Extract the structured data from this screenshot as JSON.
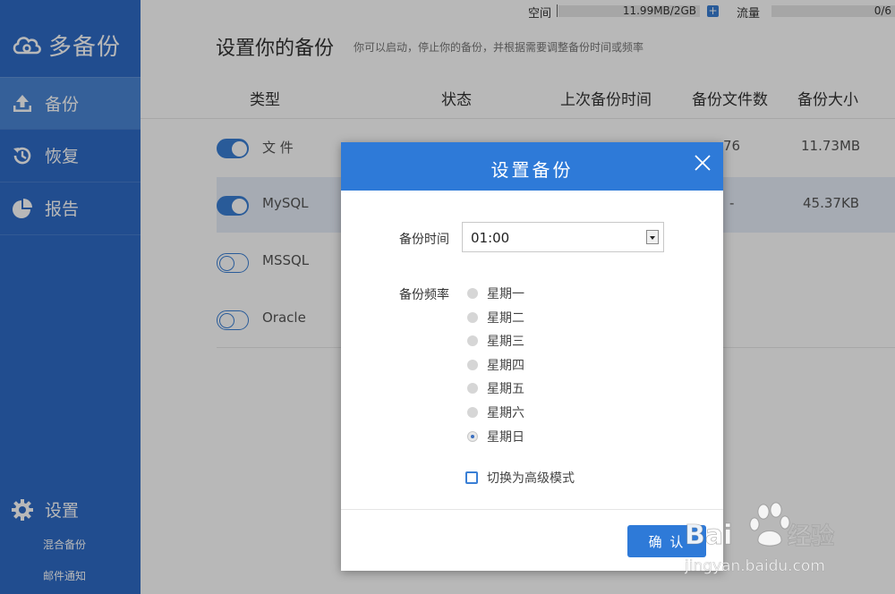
{
  "app": {
    "name": "多备份"
  },
  "sidebar": {
    "items": [
      {
        "label": "备份",
        "icon": "upload-icon",
        "active": true
      },
      {
        "label": "恢复",
        "icon": "history-icon",
        "active": false
      },
      {
        "label": "报告",
        "icon": "pie-chart-icon",
        "active": false
      }
    ],
    "settings": {
      "label": "设置",
      "icon": "gear-icon"
    },
    "sub_links": [
      "混合备份",
      "邮件通知"
    ]
  },
  "topbar": {
    "space_label": "空间",
    "space_value": "11.99MB/2GB",
    "traffic_label": "流量",
    "traffic_value": "0/6"
  },
  "page": {
    "title": "设置你的备份",
    "subtitle": "你可以启动，停止你的备份，并根据需要调整备份时间或频率"
  },
  "table": {
    "headers": [
      "类型",
      "状态",
      "上次备份时间",
      "备份文件数",
      "备份大小"
    ],
    "rows": [
      {
        "type": "文 件",
        "enabled": true,
        "files": "76",
        "size": "11.73MB"
      },
      {
        "type": "MySQL",
        "enabled": true,
        "files": "-",
        "size": "45.37KB"
      },
      {
        "type": "MSSQL",
        "enabled": false,
        "files": "",
        "size": ""
      },
      {
        "type": "Oracle",
        "enabled": false,
        "files": "",
        "size": ""
      }
    ]
  },
  "dialog": {
    "title": "设置备份",
    "time_label": "备份时间",
    "time_value": "01:00",
    "freq_label": "备份频率",
    "days": [
      {
        "label": "星期一",
        "checked": false
      },
      {
        "label": "星期二",
        "checked": false
      },
      {
        "label": "星期三",
        "checked": false
      },
      {
        "label": "星期四",
        "checked": false
      },
      {
        "label": "星期五",
        "checked": false
      },
      {
        "label": "星期六",
        "checked": false
      },
      {
        "label": "星期日",
        "checked": true
      }
    ],
    "advanced_label": "切换为高级模式",
    "confirm_label": "确 认"
  },
  "watermark": {
    "text": "Baidu经验",
    "subtext": "jingyan.baidu.com"
  },
  "colors": {
    "sidebar": "#2e6bc6",
    "accent": "#2e7ad8",
    "active_nav": "#4a86d4"
  }
}
